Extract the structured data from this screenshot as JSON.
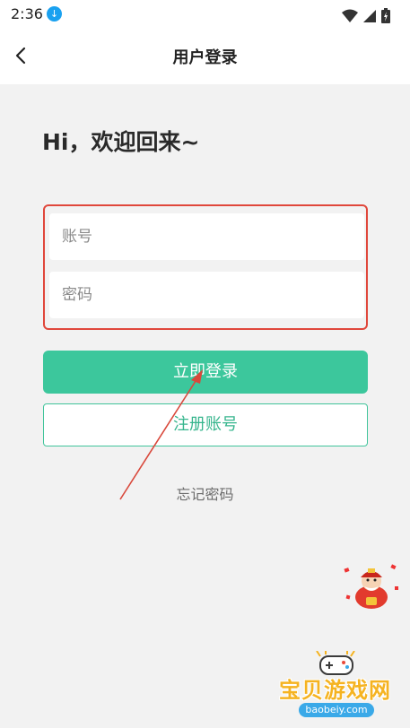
{
  "status": {
    "time": "2:36"
  },
  "header": {
    "title": "用户登录"
  },
  "greeting": "Hi，欢迎回来~",
  "form": {
    "account_placeholder": "账号",
    "password_placeholder": "密码",
    "highlight_color": "#e0473b"
  },
  "actions": {
    "login_label": "立即登录",
    "register_label": "注册账号",
    "forgot_label": "忘记密码"
  },
  "watermark": {
    "cn": "宝贝游戏网",
    "en": "baobeiy.com"
  },
  "colors": {
    "primary": "#3cc79c",
    "background": "#f2f2f2",
    "annotation": "#e0473b"
  },
  "icons": [
    "download-icon",
    "wifi-icon",
    "signal-icon",
    "battery-icon",
    "back-arrow-icon",
    "mascot-image",
    "gamepad-icon"
  ]
}
